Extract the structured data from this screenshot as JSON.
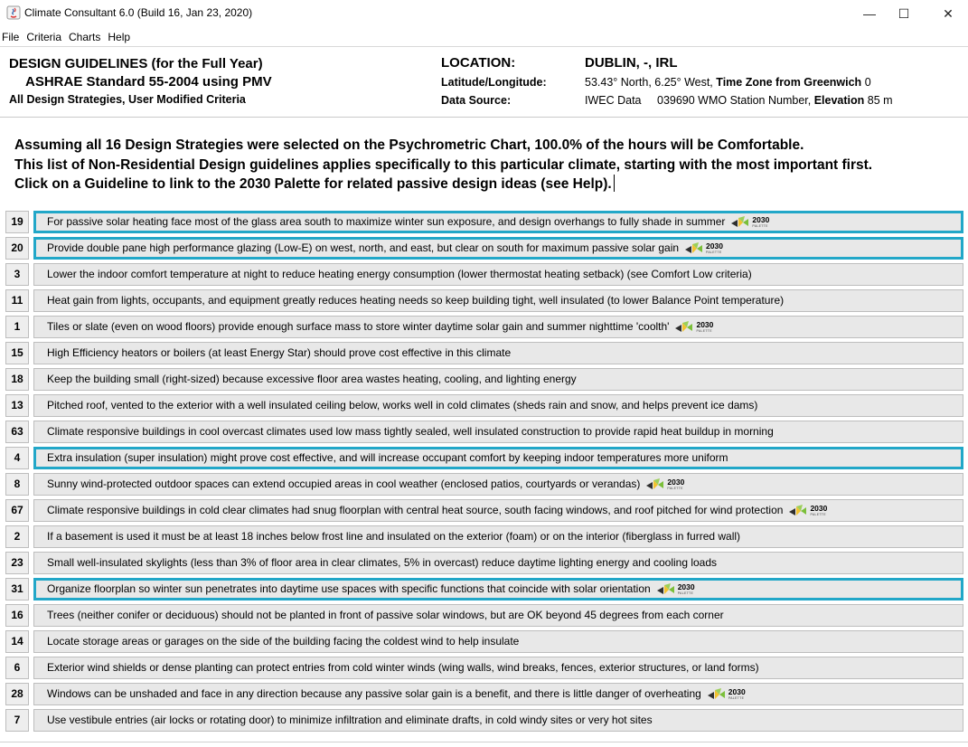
{
  "window": {
    "title": "Climate Consultant 6.0 (Build 16, Jan 23, 2020)",
    "minimize_icon": "—",
    "maximize_icon": "☐",
    "close_icon": "✕"
  },
  "menu": [
    "File",
    "Criteria",
    "Charts",
    "Help"
  ],
  "header": {
    "title": "DESIGN GUIDELINES (for the Full Year)",
    "standard": "ASHRAE Standard 55-2004 using PMV",
    "note": "All Design Strategies, User Modified Criteria",
    "location_label": "LOCATION:",
    "location_value": "DUBLIN, -, IRL",
    "latlong_label": "Latitude/Longitude:",
    "latlong_value": "53.43° North, 6.25° West,",
    "timezone_label": "Time Zone from Greenwich",
    "timezone_value": "0",
    "datasource_label": "Data Source:",
    "datasource_value": "IWEC Data",
    "station_value": "039690 WMO Station Number,",
    "elevation_label": "Elevation",
    "elevation_value": "85 m"
  },
  "intro": {
    "line1": "Assuming all 16 Design Strategies were selected on the Psychrometric Chart, 100.0% of the hours will be Comfortable.",
    "line2": "This list of Non-Residential Design guidelines applies specifically to this particular climate, starting with the most important first.",
    "line3": "Click on a Guideline to link to the 2030 Palette for related passive design ideas (see Help)."
  },
  "palette": {
    "label": "2030",
    "sub": "PALETTE"
  },
  "highlight_color": "#22a7c8",
  "guidelines": [
    {
      "num": "19",
      "text": "For passive solar heating face most of the glass area south to maximize winter sun exposure, and design overhangs to fully shade in summer",
      "palette": true,
      "highlighted": true
    },
    {
      "num": "20",
      "text": "Provide double pane high performance glazing (Low-E) on west, north, and east, but clear on south for maximum passive solar gain",
      "palette": true,
      "highlighted": true
    },
    {
      "num": "3",
      "text": "Lower the indoor comfort temperature at night to reduce heating energy consumption (lower thermostat heating setback) (see Comfort Low criteria)",
      "palette": false,
      "highlighted": false
    },
    {
      "num": "11",
      "text": "Heat gain from lights, occupants, and equipment greatly reduces heating needs so keep building tight, well insulated (to lower Balance Point temperature)",
      "palette": false,
      "highlighted": false
    },
    {
      "num": "1",
      "text": "Tiles or slate (even on wood floors) provide enough surface mass to store winter daytime solar gain and summer nighttime 'coolth'",
      "palette": true,
      "highlighted": false
    },
    {
      "num": "15",
      "text": "High Efficiency heators or boilers (at least Energy Star) should prove cost effective in this climate",
      "palette": false,
      "highlighted": false
    },
    {
      "num": "18",
      "text": "Keep the building small (right-sized) because excessive floor area wastes heating, cooling, and lighting energy",
      "palette": false,
      "highlighted": false
    },
    {
      "num": "13",
      "text": "Pitched roof, vented to the exterior with a well insulated ceiling below, works well in cold climates (sheds rain and snow, and helps prevent ice dams)",
      "palette": false,
      "highlighted": false
    },
    {
      "num": "63",
      "text": "Climate responsive buildings in cool overcast climates used low mass tightly sealed, well insulated construction to provide rapid heat buildup in morning",
      "palette": false,
      "highlighted": false
    },
    {
      "num": "4",
      "text": "Extra insulation (super insulation) might prove cost effective, and will increase occupant comfort by keeping indoor temperatures more uniform",
      "palette": false,
      "highlighted": true
    },
    {
      "num": "8",
      "text": "Sunny wind-protected outdoor spaces can extend occupied areas in cool weather (enclosed patios, courtyards or verandas)",
      "palette": true,
      "highlighted": false
    },
    {
      "num": "67",
      "text": "Climate responsive buildings in cold clear climates had snug floorplan with central heat source, south facing windows, and roof pitched for wind protection",
      "palette": true,
      "highlighted": false
    },
    {
      "num": "2",
      "text": "If a basement is used it must be at least 18 inches below frost line and insulated on the exterior (foam) or on the interior (fiberglass in furred wall)",
      "palette": false,
      "highlighted": false
    },
    {
      "num": "23",
      "text": "Small well-insulated skylights (less than 3% of floor area in clear climates, 5% in overcast) reduce daytime lighting energy and cooling loads",
      "palette": false,
      "highlighted": false
    },
    {
      "num": "31",
      "text": "Organize floorplan so winter sun penetrates into daytime use spaces with specific functions that coincide with solar orientation",
      "palette": true,
      "highlighted": true
    },
    {
      "num": "16",
      "text": "Trees (neither conifer or deciduous) should not be planted in front of passive solar windows, but are OK beyond 45 degrees from each corner",
      "palette": false,
      "highlighted": false
    },
    {
      "num": "14",
      "text": "Locate storage areas or garages on the side of the building facing the coldest wind to help insulate",
      "palette": false,
      "highlighted": false
    },
    {
      "num": "6",
      "text": "Exterior wind shields or dense planting can protect entries from cold winter winds (wing walls, wind breaks, fences, exterior structures, or land forms)",
      "palette": false,
      "highlighted": false
    },
    {
      "num": "28",
      "text": "Windows can be unshaded and face in any direction because any passive solar gain is a benefit, and there is little danger of overheating",
      "palette": true,
      "highlighted": false
    },
    {
      "num": "7",
      "text": "Use vestibule entries (air locks or rotating door) to minimize infiltration and eliminate drafts, in cold windy sites or very hot sites",
      "palette": false,
      "highlighted": false
    }
  ]
}
